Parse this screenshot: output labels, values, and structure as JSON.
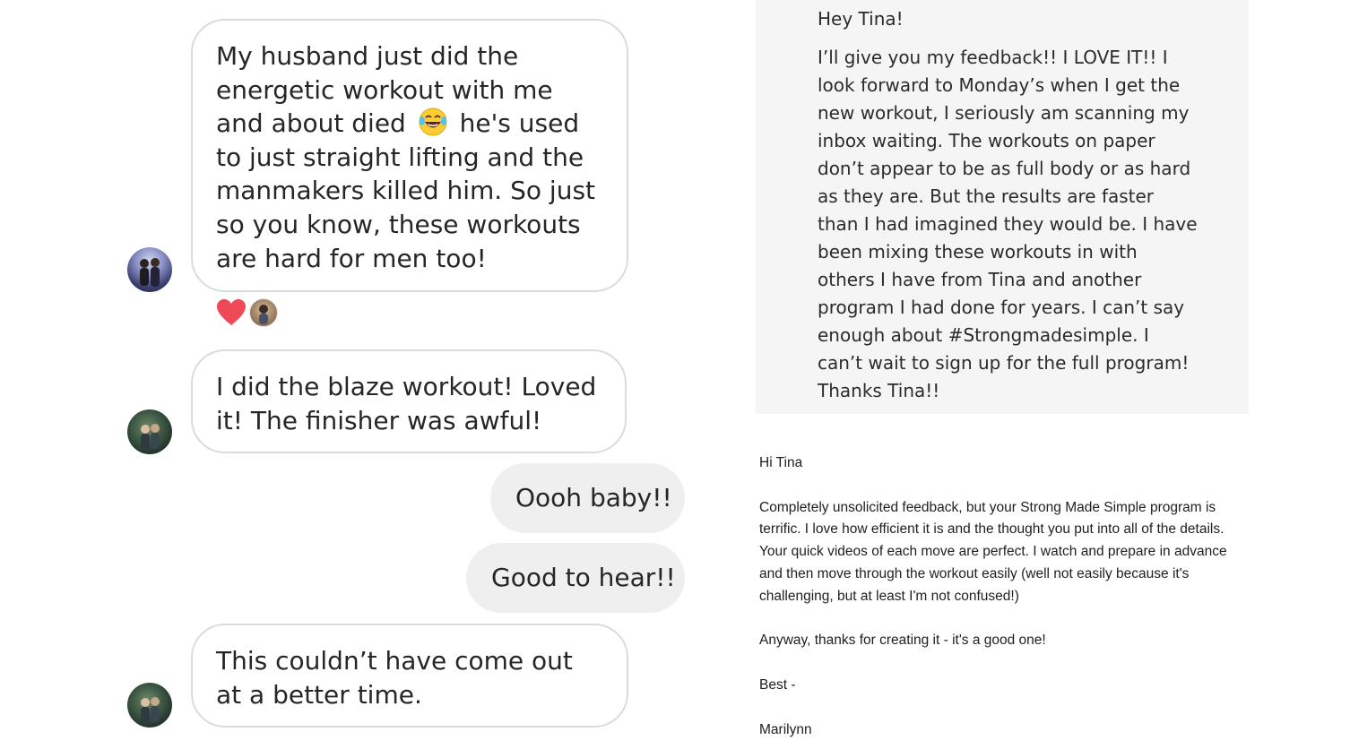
{
  "chat": {
    "messages": [
      {
        "direction": "incoming",
        "text_before_emoji": "My husband just did the energetic workout with me and about died",
        "emoji": "face-with-tears-of-joy",
        "text_after_emoji": "he's used to just straight lifting and the manmakers killed him. So just so you know, these workouts are hard for men too!",
        "reactions": [
          "heart",
          "user-avatar"
        ]
      },
      {
        "direction": "incoming",
        "text": "I did the blaze workout! Loved it! The finisher was awful!"
      },
      {
        "direction": "outgoing",
        "text": "Oooh baby!!"
      },
      {
        "direction": "outgoing",
        "text": "Good to hear!!"
      },
      {
        "direction": "incoming",
        "text": "This couldn’t have come out at a better time."
      }
    ]
  },
  "testimonial_top": {
    "greeting": "Hey Tina!",
    "body": "I’ll give you my feedback!! I LOVE IT!! I look forward to Monday’s when I get the new workout, I seriously am scanning my inbox waiting. The workouts on paper don’t appear to be as full body or as hard as they are. But the results are faster than I had imagined they would be. I have been mixing these workouts in with others I have from Tina and another program I had done for years. I can’t say enough about #Strongmadesimple. I can’t wait to sign up for the full program! Thanks Tina!!"
  },
  "testimonial_email": {
    "greeting": "Hi Tina",
    "paragraph": "Completely unsolicited feedback, but your Strong Made Simple program is terrific.  I love how efficient it is and the thought you put into all of the details.  Your quick videos of each move are perfect.  I watch and prepare in advance and then move through the workout easily (well not easily because it's challenging, but at least I'm not confused!)",
    "closing_line": "Anyway, thanks for creating it - it's a good one!",
    "signoff": "Best -",
    "signature": "Marilynn"
  },
  "colors": {
    "incoming_bubble_border": "#dbdbdb",
    "outgoing_bubble_bg": "#efefef",
    "reaction_heart": "#ed4956",
    "panel_bg": "#f5f5f5"
  }
}
